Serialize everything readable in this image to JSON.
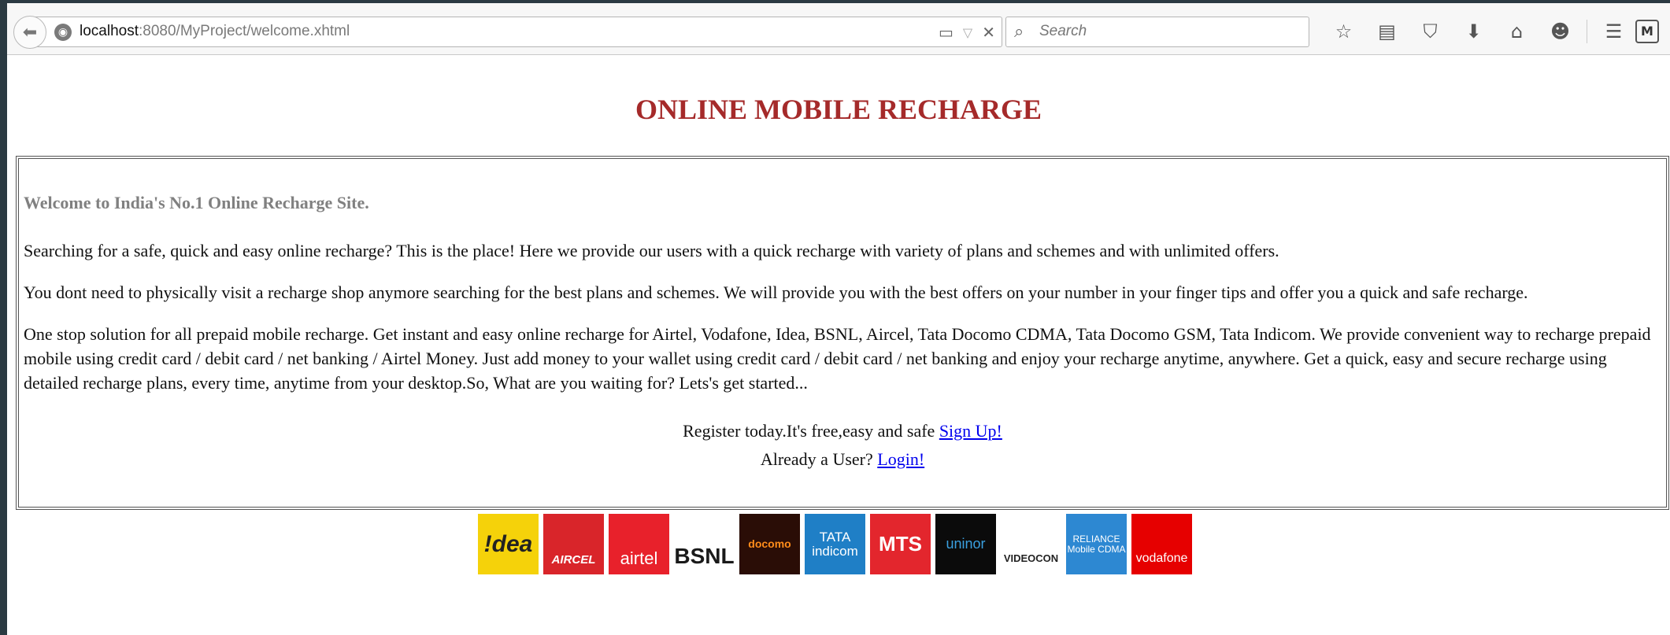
{
  "browser": {
    "url_host": "localhost",
    "url_path": ":8080/MyProject/welcome.xhtml",
    "search_placeholder": "Search"
  },
  "page": {
    "title": "ONLINE MOBILE RECHARGE",
    "welcome": "Welcome to India's No.1 Online Recharge Site.",
    "para1": "Searching for a safe, quick and easy online recharge? This is the place! Here we provide our users with a quick recharge with variety of plans and schemes and with unlimited offers.",
    "para2": "You dont need to physically visit a recharge shop anymore searching for the best plans and schemes. We will provide you with the best offers on your number in your finger tips and offer you a quick and safe recharge.",
    "para3": "One stop solution for all prepaid mobile recharge. Get instant and easy online recharge for Airtel, Vodafone, Idea, BSNL, Aircel, Tata Docomo CDMA, Tata Docomo GSM, Tata Indicom. We provide convenient way to recharge prepaid mobile using credit card / debit card / net banking / Airtel Money. Just add money to your wallet using credit card / debit card / net banking and enjoy your recharge anytime, anywhere. Get a quick, easy and secure recharge using detailed recharge plans, every time, anytime from your desktop.So, What are you waiting for? Lets's get started...",
    "register_text": "Register today.It's free,easy and safe ",
    "signup_link": "Sign Up!",
    "login_text": "Already a User? ",
    "login_link": "Login!"
  },
  "logos": [
    {
      "name": "!dea",
      "bg": "#f5d20a",
      "fg": "#222222"
    },
    {
      "name": "AIRCEL",
      "bg": "#d9252a",
      "fg": "#ffffff"
    },
    {
      "name": "airtel",
      "bg": "#e8212b",
      "fg": "#ffffff"
    },
    {
      "name": "BSNL",
      "bg": "#ffffff",
      "fg": "#1a1a1a"
    },
    {
      "name": "docomo",
      "bg": "#2a0d06",
      "fg": "#ff8c1a"
    },
    {
      "name": "TATA indicom",
      "bg": "#1f7fc6",
      "fg": "#ffffff"
    },
    {
      "name": "MTS",
      "bg": "#e3262d",
      "fg": "#ffffff"
    },
    {
      "name": "uninor",
      "bg": "#0b0b0b",
      "fg": "#3aa0e0"
    },
    {
      "name": "VIDEOCON",
      "bg": "#ffffff",
      "fg": "#222222"
    },
    {
      "name": "RELIANCE Mobile CDMA",
      "bg": "#2d88d2",
      "fg": "#ffffff"
    },
    {
      "name": "vodafone",
      "bg": "#e60000",
      "fg": "#ffffff"
    }
  ]
}
